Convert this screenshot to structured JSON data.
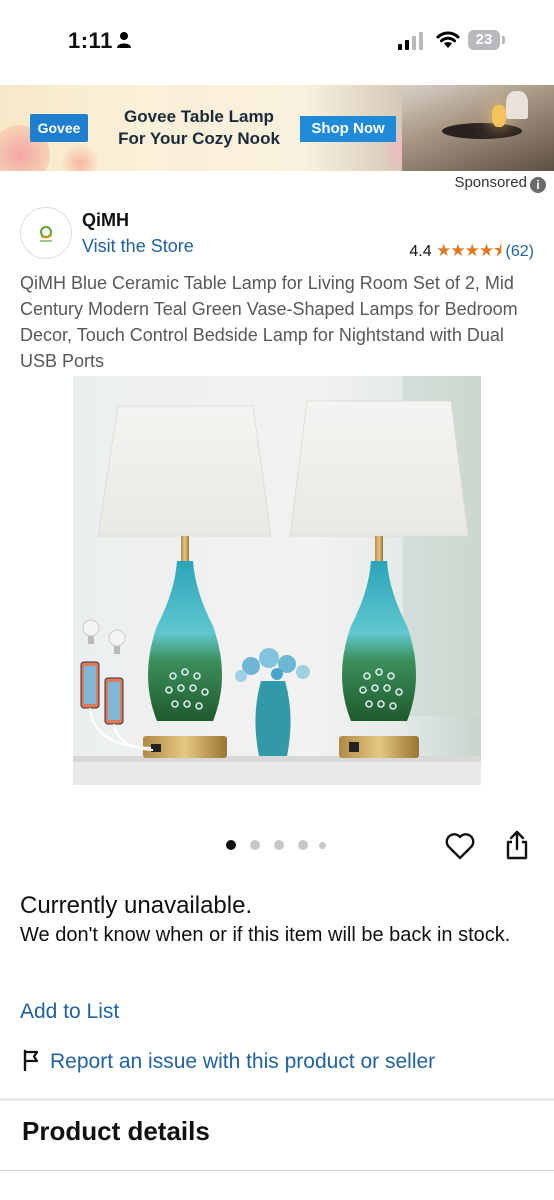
{
  "status_bar": {
    "time": "1:11",
    "battery": "23"
  },
  "ad": {
    "brand": "Govee",
    "headline_line1": "Govee Table Lamp",
    "headline_line2": "For Your Cozy Nook",
    "cta": "Shop Now",
    "sponsored_label": "Sponsored"
  },
  "store": {
    "brand_name": "QiMH",
    "visit_label": "Visit the Store",
    "rating_value": "4.4",
    "rating_count": "(62)",
    "stars_display": "★★★★⯨"
  },
  "product": {
    "title": "QiMH Blue Ceramic Table Lamp for Living Room Set of 2, Mid Century Modern Teal Green Vase-Shaped Lamps for Bedroom Decor, Touch Control Bedside Lamp for Nightstand with Dual USB Ports",
    "image_count": 5,
    "current_image": 1
  },
  "availability": {
    "status": "Currently unavailable.",
    "detail": "We don't know when or if this item will be back in stock."
  },
  "actions": {
    "add_to_list": "Add to List",
    "report_issue": "Report an issue with this product or seller"
  },
  "sections": {
    "product_details": "Product details"
  },
  "colors": {
    "link": "#2162a1",
    "star": "#de7921",
    "text": "#0f1111"
  },
  "icons": [
    "person-icon",
    "signal-icon",
    "wifi-icon",
    "battery-icon",
    "info-icon",
    "heart-icon",
    "share-icon",
    "flag-icon"
  ]
}
